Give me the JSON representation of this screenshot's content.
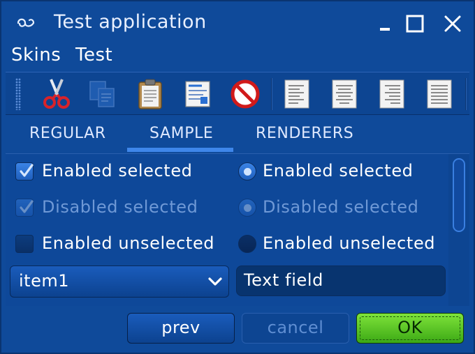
{
  "window": {
    "title": "Test application",
    "controls": {
      "minimize_icon": "minimize-icon",
      "maximize_icon": "maximize-icon",
      "close_icon": "close-icon"
    }
  },
  "menu": [
    {
      "label": "Skins"
    },
    {
      "label": "Test"
    }
  ],
  "toolbar": {
    "buttons": [
      {
        "icon": "cut-icon"
      },
      {
        "icon": "copy-icon"
      },
      {
        "icon": "paste-icon"
      },
      {
        "icon": "format-icon"
      },
      {
        "icon": "stop-icon"
      },
      {
        "icon": "align-left-icon"
      },
      {
        "icon": "align-center-icon"
      },
      {
        "icon": "align-right-icon"
      },
      {
        "icon": "align-justify-icon"
      }
    ]
  },
  "tabs": [
    {
      "label": "REGULAR",
      "selected": false
    },
    {
      "label": "SAMPLE",
      "selected": true
    },
    {
      "label": "RENDERERS",
      "selected": false
    }
  ],
  "sample": {
    "checkboxes": [
      {
        "label": "Enabled selected",
        "checked": true,
        "enabled": true
      },
      {
        "label": "Disabled selected",
        "checked": true,
        "enabled": false
      },
      {
        "label": "Enabled unselected",
        "checked": false,
        "enabled": true
      }
    ],
    "radios": [
      {
        "label": "Enabled selected",
        "selected": true,
        "enabled": true
      },
      {
        "label": "Disabled selected",
        "selected": true,
        "enabled": false
      },
      {
        "label": "Enabled unselected",
        "selected": false,
        "enabled": true
      }
    ],
    "combo": {
      "value": "item1"
    },
    "text_field": {
      "value": "Text field"
    }
  },
  "buttons": {
    "prev": "prev",
    "cancel": "cancel",
    "ok": "OK"
  },
  "colors": {
    "background": "#0f4a9a",
    "accent": "#3e86ea",
    "ok_button": "#5cc825"
  }
}
